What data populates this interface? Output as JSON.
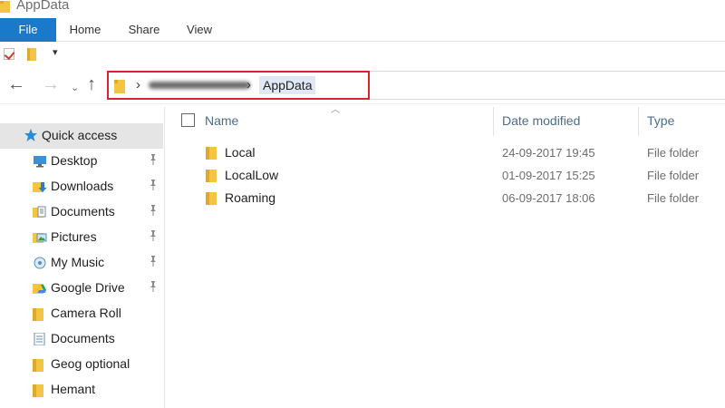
{
  "window": {
    "title": "AppData"
  },
  "ribbon": {
    "tabs": [
      "File",
      "Home",
      "Share",
      "View"
    ]
  },
  "qat": {
    "dropdown_glyph": "▾"
  },
  "nav": {
    "back": "←",
    "forward": "→",
    "recent": "⌄",
    "up": "↑",
    "separator": "›",
    "current_folder": "AppData"
  },
  "sidebar": {
    "quick_access": "Quick access",
    "items": [
      {
        "label": "Desktop",
        "pinned": true,
        "icon": "desktop-icon"
      },
      {
        "label": "Downloads",
        "pinned": true,
        "icon": "downloads-icon"
      },
      {
        "label": "Documents",
        "pinned": true,
        "icon": "documents-icon"
      },
      {
        "label": "Pictures",
        "pinned": true,
        "icon": "pictures-icon"
      },
      {
        "label": "My Music",
        "pinned": true,
        "icon": "music-icon"
      },
      {
        "label": "Google Drive",
        "pinned": true,
        "icon": "google-drive-icon"
      },
      {
        "label": "Camera Roll",
        "pinned": false,
        "icon": "folder-icon"
      },
      {
        "label": "Documents",
        "pinned": false,
        "icon": "documents-icon"
      },
      {
        "label": "Geog optional",
        "pinned": false,
        "icon": "folder-icon"
      },
      {
        "label": "Hemant",
        "pinned": false,
        "icon": "folder-icon"
      }
    ],
    "pin_glyph": "📌"
  },
  "columns": {
    "name": "Name",
    "date_modified": "Date modified",
    "type": "Type"
  },
  "files": [
    {
      "name": "Local",
      "date": "24-09-2017 19:45",
      "type": "File folder"
    },
    {
      "name": "LocalLow",
      "date": "01-09-2017 15:25",
      "type": "File folder"
    },
    {
      "name": "Roaming",
      "date": "06-09-2017 18:06",
      "type": "File folder"
    }
  ],
  "colors": {
    "accent": "#1979ca",
    "highlight_box": "#d9232e",
    "folder": "#f4c542",
    "selected": "#e5e5e5"
  }
}
